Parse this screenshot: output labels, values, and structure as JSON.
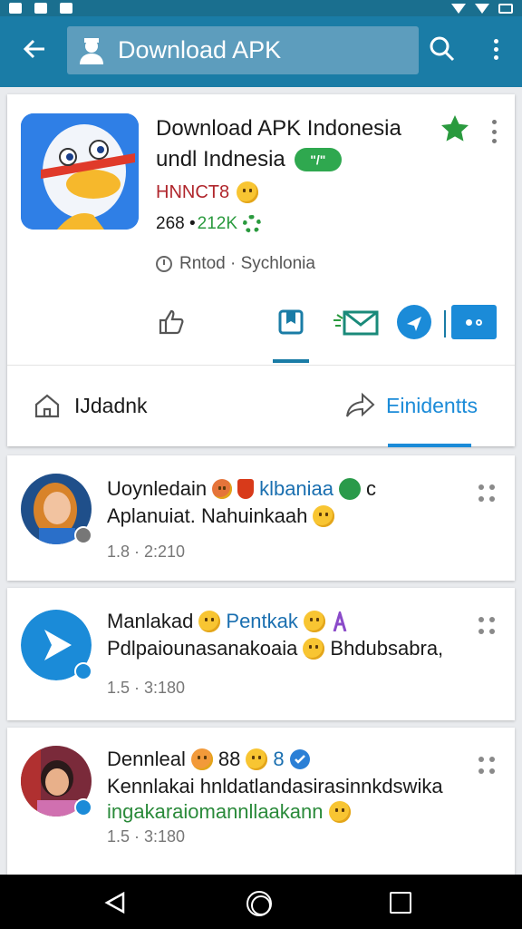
{
  "appbar": {
    "title": "Download APK"
  },
  "app_card": {
    "name": "Download APK Indonesia",
    "subtitle": "undl Indnesia",
    "pill_text": "\"/\"",
    "developer": "HNNCT8",
    "downloads": "268 •",
    "rating": "212K",
    "meta": "Rntod · Sychlonia",
    "tabs": {
      "home": "IJdadnk",
      "events": "Einidentts"
    }
  },
  "posts": [
    {
      "name": "Uoynledain",
      "name_extra": "klbaniaa",
      "name_tail": "c",
      "text": "Aplanuiat. Nahuinkaah",
      "time": "1.8 · 2:210"
    },
    {
      "name": "Manlakad",
      "name_extra": "Pentkak",
      "text": "Pdlpaiounasanakoaia",
      "text_tail": "Bhdubsabra,",
      "time": "1.5 · 3:180"
    },
    {
      "name": "Dennleal",
      "name_extra": "88",
      "name_num": "8",
      "text": "Kennlakai hnldatlandasirasinnkdswika",
      "text2": "ingakaraiomannllaakann",
      "time": "1.5 · 3:180"
    }
  ],
  "colors": {
    "appbar": "#1a7ca6",
    "accent": "#1b8bd8",
    "star": "#2a9a3e",
    "developer": "#b0262c"
  },
  "icons": [
    "back-arrow-icon",
    "user-icon",
    "search-icon",
    "more-vert-icon",
    "star-icon",
    "thumbs-up-icon",
    "bookmark-icon",
    "mail-icon",
    "share-icon",
    "home-icon",
    "share-arrow-icon"
  ]
}
